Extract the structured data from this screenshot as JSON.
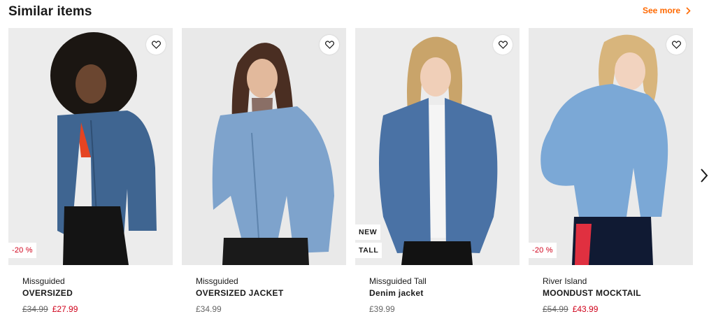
{
  "section": {
    "title": "Similar items",
    "see_more_label": "See more",
    "accent_color": "#ff6900",
    "sale_color": "#d0021b"
  },
  "products": [
    {
      "brand": "Missguided",
      "name": "OVERSIZED",
      "price_old": "£34.99",
      "price_new": "£27.99",
      "discount": "-20 %",
      "jacket_color": "#3f6591",
      "bg_color": "#ececec"
    },
    {
      "brand": "Missguided",
      "name": "OVERSIZED JACKET",
      "price": "£34.99",
      "jacket_color": "#7ea3cc",
      "bg_color": "#e9e9e9"
    },
    {
      "brand": "Missguided Tall",
      "name": "Denim jacket",
      "price": "£39.99",
      "flags": [
        "NEW",
        "TALL"
      ],
      "jacket_color": "#4a72a5",
      "bg_color": "#ececec"
    },
    {
      "brand": "River Island",
      "name": "MOONDUST MOCKTAIL",
      "price_old": "£54.99",
      "price_new": "£43.99",
      "discount": "-20 %",
      "jacket_color": "#7ba8d6",
      "bg_color": "#eaeaea"
    }
  ],
  "icons": {
    "wishlist": "heart-outline-icon",
    "see_more": "chevron-right-icon",
    "carousel_next": "chevron-right-icon"
  }
}
